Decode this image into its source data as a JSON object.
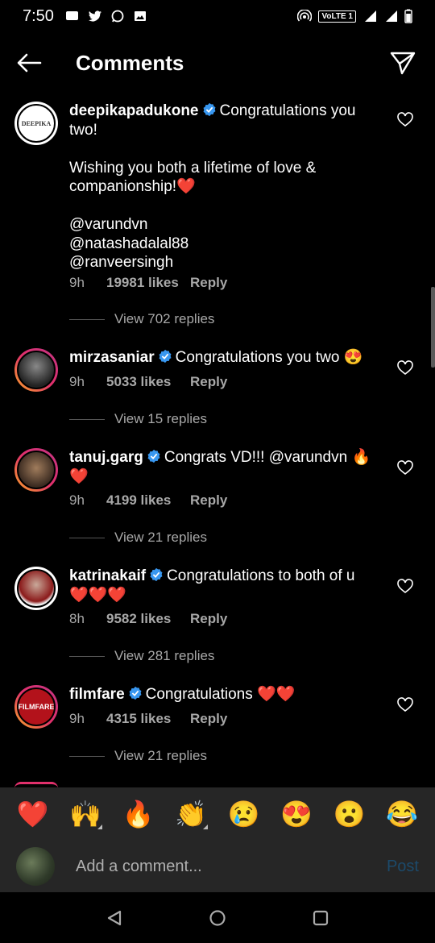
{
  "status_bar": {
    "time": "7:50",
    "network": "VoLTE 1",
    "signal": "4G"
  },
  "header": {
    "title": "Comments"
  },
  "comments": [
    {
      "username": "deepikapadukone",
      "text": "Congratulations you two!\n\nWishing you both a lifetime of love & companionship!❤️\n\n@varundvn\n@natashadalal88\n@ranveersingh",
      "time": "9h",
      "likes": "19981 likes",
      "reply_label": "Reply",
      "view_replies": "View 702 replies",
      "avatar_text": "DEEPIKA"
    },
    {
      "username": "mirzasaniar",
      "text": "Congratulations you two 😍",
      "time": "9h",
      "likes": "5033 likes",
      "reply_label": "Reply",
      "view_replies": "View 15 replies"
    },
    {
      "username": "tanuj.garg",
      "text": "Congrats VD!!! @varundvn 🔥❤️",
      "time": "9h",
      "likes": "4199 likes",
      "reply_label": "Reply",
      "view_replies": "View 21 replies"
    },
    {
      "username": "katrinakaif",
      "text": "Congratulations to both of u ❤️❤️❤️",
      "time": "8h",
      "likes": "9582 likes",
      "reply_label": "Reply",
      "view_replies": "View 281 replies"
    },
    {
      "username": "filmfare",
      "text": "Congratulations ❤️❤️",
      "time": "9h",
      "likes": "4315 likes",
      "reply_label": "Reply",
      "view_replies": "View 21 replies",
      "avatar_text": "FILMFARE"
    }
  ],
  "emoji_bar": [
    "❤️",
    "🙌",
    "🔥",
    "👏",
    "😢",
    "😍",
    "😮",
    "😂"
  ],
  "input": {
    "placeholder": "Add a comment...",
    "post_label": "Post"
  },
  "colors": {
    "background": "#000000",
    "secondary_text": "#a8a8a8",
    "verified_blue": "#3897f0",
    "post_disabled": "#1c4a6b"
  }
}
